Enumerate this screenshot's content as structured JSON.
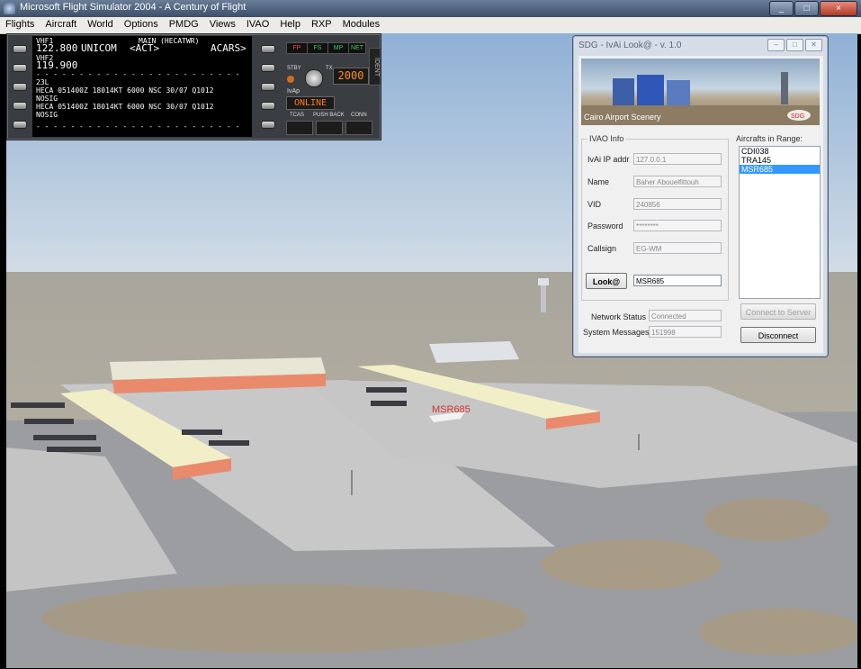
{
  "window": {
    "title": "Microsoft Flight Simulator 2004 - A Century of Flight",
    "buttons": [
      "_",
      "□",
      "×"
    ]
  },
  "menu": [
    "Flights",
    "Aircraft",
    "World",
    "Options",
    "PMDG",
    "Views",
    "IVAO",
    "Help",
    "RXP",
    "Modules"
  ],
  "acars": {
    "vhf1_label": "VHF1",
    "main_label": "MAIN (HECATWR)",
    "freq1": "122.800",
    "unicom": "UNICOM",
    "act": "<ACT>",
    "acars_label": "ACARS>",
    "vhf2_label": "VHF2",
    "freq2": "119.900",
    "dashes": "- - - - - - - - - - - - - - - - - - - - - - - -",
    "runway": "23L",
    "metar1": "HECA 051400Z 18014KT 6000 NSC 30/07 Q1012",
    "nosig1": "NOSIG",
    "metar2": "HECA 051400Z 18014KT 6000 NSC 30/07 Q1012",
    "nosig2": "NOSIG",
    "fp": "FP",
    "fs": "FS",
    "mp": "MP",
    "net": "NET",
    "stby": "STBY",
    "tx": "TX",
    "squawk": "2000",
    "ident": "IDENT",
    "ivap": "IvAp",
    "status": "ONLINE",
    "tcas": "TCAS",
    "pushback": "PUSH BACK",
    "conn": "CONN"
  },
  "scene": {
    "callsign_label": "MSR685",
    "colors": {
      "sky_top": "#8fb1d6",
      "sky_bottom": "#cfdce6",
      "ground": "#b7ae9e",
      "apron": "#c5c5c6",
      "taxiway": "#9b9c9f",
      "terminal_roof": "#f0eed2",
      "terminal_wall": "#e98a6d"
    }
  },
  "dialog": {
    "title": "SDG - IvAi Look@ - v. 1.0",
    "banner_caption": "Cairo Airport Scenery",
    "banner_logo": "SDG",
    "ivao_info_label": "IVAO Info",
    "fields": [
      {
        "label": "IvAi IP addr",
        "value": "127.0.0.1"
      },
      {
        "label": "Name",
        "value": "Baher Abouelfittouh"
      },
      {
        "label": "VID",
        "value": "240856"
      },
      {
        "label": "Password",
        "value": "********"
      },
      {
        "label": "Callsign",
        "value": "EG-WM"
      }
    ],
    "look_button": "Look@",
    "look_value": "MSR685",
    "aircraft_label": "Aircrafts in Range:",
    "aircraft": [
      "CDI038",
      "TRA145",
      "MSR685"
    ],
    "selected_aircraft": "MSR685",
    "network_status_label": "Network Status",
    "network_status": "Connected",
    "system_messages_label": "System Messages",
    "system_messages": "151998",
    "connect_button": "Connect to Server",
    "disconnect_button": "Disconnect"
  }
}
